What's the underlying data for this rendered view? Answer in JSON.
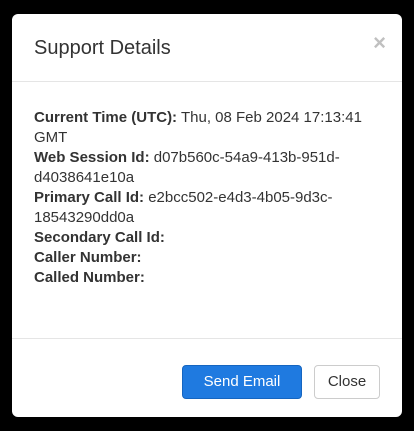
{
  "dialog": {
    "title": "Support Details",
    "close_glyph": "×"
  },
  "details": {
    "current_time_label": "Current Time (UTC):",
    "current_time_value": "Thu, 08 Feb 2024 17:13:41 GMT",
    "web_session_label": "Web Session Id:",
    "web_session_value": "d07b560c-54a9-413b-951d-d4038641e10a",
    "primary_call_label": "Primary Call Id:",
    "primary_call_value": "e2bcc502-e4d3-4b05-9d3c-18543290dd0a",
    "secondary_call_label": "Secondary Call Id:",
    "secondary_call_value": "",
    "caller_number_label": "Caller Number:",
    "caller_number_value": "",
    "called_number_label": "Called Number:",
    "called_number_value": ""
  },
  "footer": {
    "send_email_label": "Send Email",
    "close_label": "Close"
  },
  "colors": {
    "primary_button": "#1f7ae0",
    "backdrop": "#000000"
  }
}
